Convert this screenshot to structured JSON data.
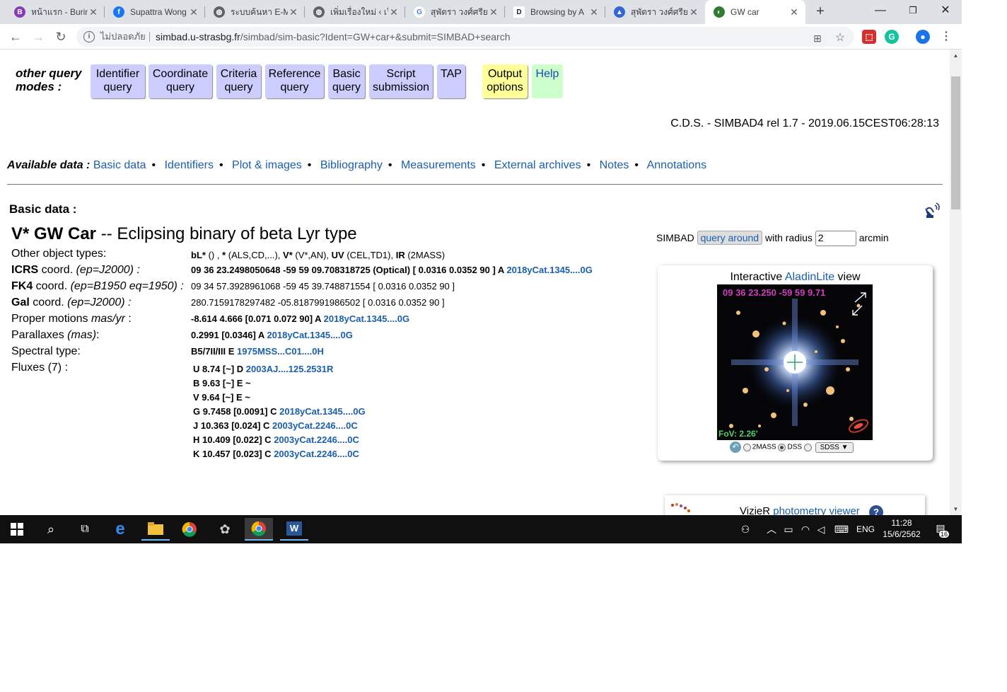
{
  "browser": {
    "tabs": [
      {
        "title": "หน้าแรก - Burin",
        "favicon_color": "#8a3bb8",
        "favicon_glyph": "B"
      },
      {
        "title": "Supattra Wong",
        "favicon_color": "#1877f2",
        "favicon_glyph": "f"
      },
      {
        "title": "ระบบค้นหา E-M",
        "favicon_color": "#5f6368",
        "favicon_glyph": "globe-icon"
      },
      {
        "title": "เพิ่มเรื่องใหม่ ‹ เว็",
        "favicon_color": "#5f6368",
        "favicon_glyph": "globe-icon"
      },
      {
        "title": "สุพัตรา วงศ์ศรียา",
        "favicon_color": "#4285f4",
        "favicon_glyph": "G"
      },
      {
        "title": "Browsing by A",
        "favicon_color": "#202124",
        "favicon_glyph": "D"
      },
      {
        "title": "สุพัตรา วงศ์ศรียา",
        "favicon_color": "#3367d6",
        "favicon_glyph": "scholar-icon"
      },
      {
        "title": "GW car",
        "favicon_color": "#2d7d32",
        "favicon_glyph": "simbad-icon"
      }
    ],
    "insecure_label": "ไม่ปลอดภัย",
    "url_host": "simbad.u-strasbg.fr",
    "url_path": "/simbad/sim-basic?Ident=GW+car+&submit=SIMBAD+search"
  },
  "page": {
    "modes_label_line1": "other query",
    "modes_label_line2": "modes :",
    "modes": [
      {
        "line1": "Identifier",
        "line2": "query"
      },
      {
        "line1": "Coordinate",
        "line2": "query"
      },
      {
        "line1": "Criteria",
        "line2": "query"
      },
      {
        "line1": "Reference",
        "line2": "query"
      },
      {
        "line1": "Basic",
        "line2": "query"
      },
      {
        "line1": "Script",
        "line2": "submission"
      },
      {
        "line1": "TAP",
        "line2": ""
      },
      {
        "line1": "Output",
        "line2": "options"
      },
      {
        "line1": "Help",
        "line2": ""
      }
    ],
    "release": "C.D.S. - SIMBAD4 rel 1.7 - 2019.06.15CEST06:28:13",
    "available_label": "Available data :",
    "available_links": [
      "Basic data",
      "Identifiers",
      "Plot & images",
      "Bibliography",
      "Measurements",
      "External archives",
      "Notes",
      "Annotations"
    ],
    "basic_title": "Basic data :",
    "object": {
      "name": "V* GW Car",
      "sep": " -- ",
      "type": "Eclipsing binary of beta Lyr type"
    },
    "labels": {
      "other_types": "Other object types:",
      "icrs_bold": "ICRS",
      "icrs_rest": " coord.",
      "icrs_ep": " (ep=J2000) :",
      "fk4_bold": "FK4",
      "fk4_rest": " coord.",
      "fk4_ep": " (ep=B1950 eq=1950) :",
      "gal_bold": "Gal",
      "gal_rest": " coord.",
      "gal_ep": " (ep=J2000) :",
      "pm": "Proper motions ",
      "pm_unit": "mas/yr",
      "pm_colon": " :",
      "plx": "Parallaxes ",
      "plx_unit": "(mas)",
      "plx_colon": ":",
      "sptype": "Spectral type:",
      "fluxes": "Fluxes (7) :"
    },
    "values": {
      "other_types": [
        {
          "code": "bL*",
          "src": " () ,  "
        },
        {
          "code": "*",
          "src": " (ALS,CD,...),  "
        },
        {
          "code": "V*",
          "src": " (V*,AN),  "
        },
        {
          "code": "UV",
          "src": " (CEL,TD1),  "
        },
        {
          "code": "IR",
          "src": " (2MASS)"
        }
      ],
      "icrs": "09 36 23.2498050648 -59 59 09.708318725 (Optical) [ 0.0316 0.0352 90 ] A ",
      "icrs_ref": "2018yCat.1345....0G",
      "fk4": "09 34 57.3928961068 -59 45 39.748871554 [ 0.0316 0.0352 90 ]",
      "gal": "280.7159178297482 -05.8187991986502 [ 0.0316 0.0352 90 ]",
      "pm": "-8.614 4.666 [0.071 0.072 90] A ",
      "pm_ref": "2018yCat.1345....0G",
      "plx": "0.2991 [0.0346] A ",
      "plx_ref": "2018yCat.1345....0G",
      "sptype": "B5/7II/III E ",
      "sptype_ref": "1975MSS...C01....0H"
    },
    "fluxes": [
      {
        "text": "U 8.74 [~] D ",
        "ref": "2003AJ....125.2531R"
      },
      {
        "text": "B 9.63 [~] E ~",
        "ref": ""
      },
      {
        "text": "V 9.64 [~] E ~",
        "ref": ""
      },
      {
        "text": "G 9.7458 [0.0091] C ",
        "ref": "2018yCat.1345....0G"
      },
      {
        "text": "J 10.363 [0.024] C ",
        "ref": "2003yCat.2246....0C"
      },
      {
        "text": "H 10.409 [0.022] C ",
        "ref": "2003yCat.2246....0C"
      },
      {
        "text": "K 10.457 [0.023] C ",
        "ref": "2003yCat.2246....0C"
      }
    ],
    "around": {
      "prefix": "SIMBAD",
      "button": "query around",
      "mid": "with radius",
      "radius": "2",
      "unit": "arcmin"
    },
    "aladin": {
      "title_pre": "Interactive ",
      "title_link": "AladinLite",
      "title_post": " view",
      "coord": "09 36 23.250 -59 59 9.71",
      "fov": "FoV: 2.26'",
      "survey_2mass": "2MASS",
      "survey_dss": "DSS",
      "survey_select": "SDSS"
    },
    "vizier": {
      "pre": "VizieR ",
      "link": "photometry viewer"
    }
  },
  "taskbar": {
    "lang": "ENG",
    "time": "11:28",
    "date": "15/6/2562",
    "notifications": "16"
  }
}
